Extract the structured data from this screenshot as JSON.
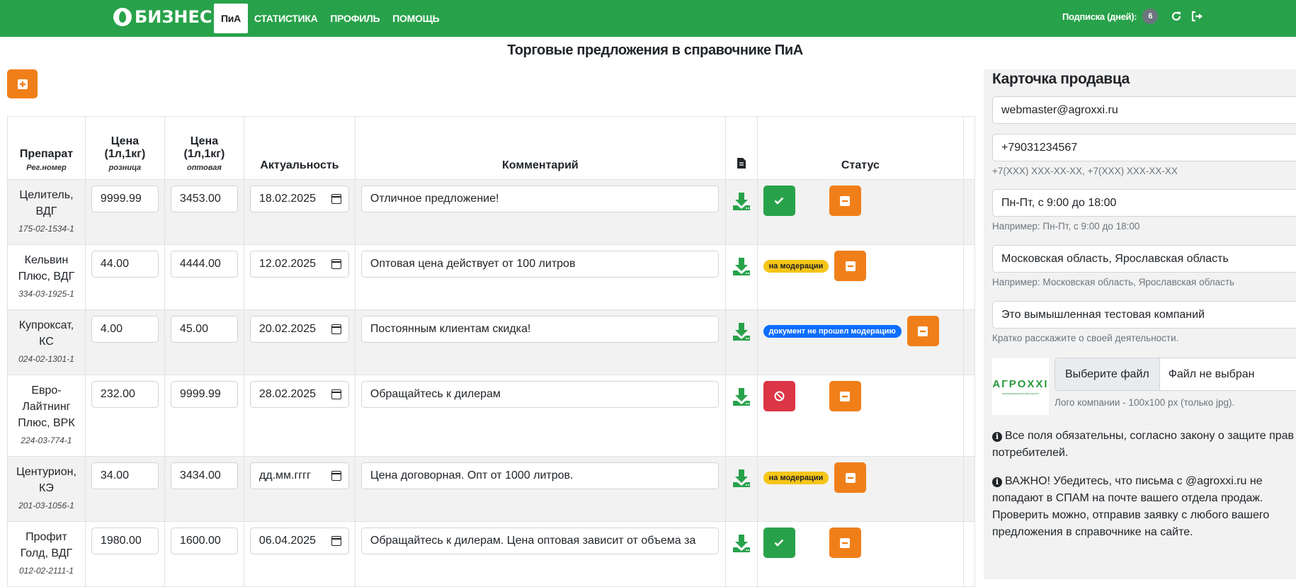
{
  "nav": {
    "brand": "БИЗНЕС",
    "links": [
      {
        "label": "ПиА",
        "active": true
      },
      {
        "label": "СТАТИСТИКА",
        "active": false
      },
      {
        "label": "ПРОФИЛЬ",
        "active": false
      },
      {
        "label": "ПОМОЩЬ",
        "active": false
      }
    ],
    "subscription_label": "Подписка (дней):",
    "subscription_days": "6",
    "colors": {
      "bar": "#28a24a",
      "accent": "#f07f1a"
    }
  },
  "page": {
    "title": "Торговые предложения в справочнике ПиА"
  },
  "table": {
    "headers": {
      "drug": "Препарат",
      "drug_sub": "Рег.номер",
      "price_retail": "Цена (1л,1кг)",
      "price_retail_sub": "розница",
      "price_wholesale": "Цена (1л,1кг)",
      "price_wholesale_sub": "оптовая",
      "actuality": "Актуальность",
      "comment": "Комментарий",
      "status": "Статус"
    },
    "rows": [
      {
        "name": "Целитель, ВДГ",
        "reg": "175-02-1534-1",
        "retail": "9999.99",
        "wholesale": "3453.00",
        "date": "18.02.2025",
        "comment": "Отличное предложение!",
        "status_icon": "check-icon",
        "status_badge": ""
      },
      {
        "name": "Кельвин Плюс, ВДГ",
        "reg": "334-03-1925-1",
        "retail": "44.00",
        "wholesale": "4444.00",
        "date": "12.02.2025",
        "comment": "Оптовая цена действует от 100 литров",
        "status_icon": "",
        "status_badge": "на модерации"
      },
      {
        "name": "Купроксат, КС",
        "reg": "024-02-1301-1",
        "retail": "4.00",
        "wholesale": "45.00",
        "date": "20.02.2025",
        "comment": "Постоянным клиентам скидка!",
        "status_icon": "",
        "status_badge": "документ не прошел модерацию"
      },
      {
        "name": "Евро-Лайтнинг Плюс, ВРК",
        "reg": "224-03-774-1",
        "retail": "232.00",
        "wholesale": "9999.99",
        "date": "28.02.2025",
        "comment": "Обращайтесь к дилерам",
        "status_icon": "ban-icon",
        "status_badge": ""
      },
      {
        "name": "Центурион, КЭ",
        "reg": "201-03-1056-1",
        "retail": "34.00",
        "wholesale": "3434.00",
        "date": "дд.мм.гггг",
        "comment": "Цена договорная. Опт от 1000 литров.",
        "status_icon": "",
        "status_badge": "на модерации"
      },
      {
        "name": "Профит Голд, ВДГ",
        "reg": "012-02-2111-1",
        "retail": "1980.00",
        "wholesale": "1600.00",
        "date": "06.04.2025",
        "comment": "Обращайтесь к дилерам. Цена оптовая зависит от объема за",
        "status_icon": "check-icon",
        "status_badge": ""
      }
    ]
  },
  "seller": {
    "title": "Карточка продавца",
    "email": "webmaster@agroxxi.ru",
    "phone": "+79031234567",
    "phone_hint": "+7(XXX) XXX-XX-XX, +7(XXX) XXX-XX-XX",
    "hours": "Пн-Пт, с 9:00 до 18:00",
    "hours_hint": "Например: Пн-Пт, с 9:00 до 18:00",
    "regions": "Московская область, Ярославская область",
    "regions_hint": "Например: Московская область, Ярославская область",
    "about": "Это вымышленная тестовая компаний",
    "about_hint": "Кратко расскажите о своей деятельности.",
    "logo_text": "АГРOXXI",
    "file_button": "Выберите файл",
    "file_none": "Файл не выбран",
    "logo_hint": "Лого компании - 100x100 px (только jpg).",
    "note1": "Все поля обязательны, согласно закону о защите прав потребителей.",
    "note2": "ВАЖНО! Убедитесь, что письма с @agroxxi.ru не попадают в СПАМ на почте вашего отдела продаж. Проверить можно, отправив заявку с любого вашего предложения в справочнике на сайте."
  }
}
